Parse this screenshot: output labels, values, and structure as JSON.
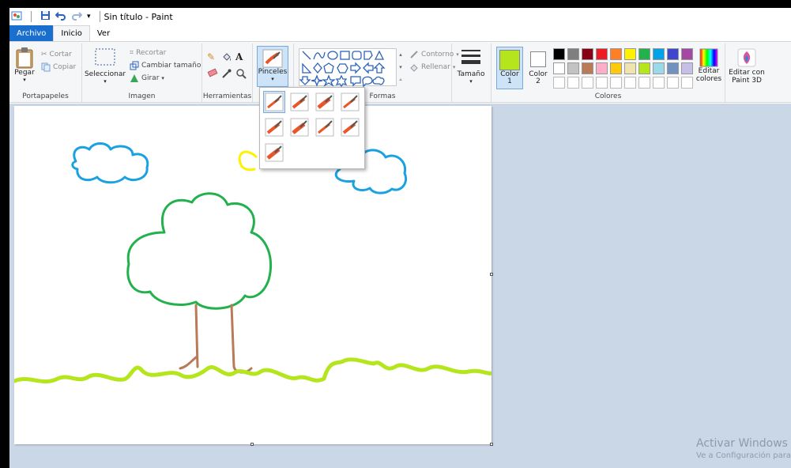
{
  "titlebar": {
    "title": "Sin título - Paint",
    "icons": [
      "paint-app-icon",
      "save-icon",
      "undo-icon",
      "redo-icon",
      "customize-qat-icon"
    ]
  },
  "tabs": {
    "file": "Archivo",
    "home": "Inicio",
    "view": "Ver"
  },
  "clipboard": {
    "paste": "Pegar",
    "cut": "Cortar",
    "copy": "Copiar",
    "title": "Portapapeles"
  },
  "image": {
    "select": "Seleccionar",
    "crop": "Recortar",
    "resize": "Cambiar tamaño",
    "rotate": "Girar",
    "title": "Imagen"
  },
  "tools": {
    "title": "Herramientas"
  },
  "brushes": {
    "label": "Pinceles"
  },
  "shapes": {
    "outline": "Contorno",
    "fill": "Rellenar",
    "title": "Formas"
  },
  "size": {
    "label": "Tamaño"
  },
  "colors": {
    "color1_label": "Color",
    "color1_num": "1",
    "color2_label": "Color",
    "color2_num": "2",
    "edit": "Editar colores",
    "title": "Colores",
    "color1": "#b5e61d",
    "color2": "#ffffff",
    "palette_row1": [
      "#000000",
      "#7f7f7f",
      "#880015",
      "#ed1c24",
      "#ff7f27",
      "#fff200",
      "#22b14c",
      "#00a2e8",
      "#3f48cc",
      "#a349a4"
    ],
    "palette_row2": [
      "#ffffff",
      "#c3c3c3",
      "#b97a57",
      "#ffaec9",
      "#ffc90e",
      "#efe4b0",
      "#b5e61d",
      "#99d9ea",
      "#7092be",
      "#c8bfe7"
    ],
    "palette_row3": [
      "#ffffff",
      "#ffffff",
      "#ffffff",
      "#ffffff",
      "#ffffff",
      "#ffffff",
      "#ffffff",
      "#ffffff",
      "#ffffff",
      "#ffffff"
    ]
  },
  "paint3d": {
    "label": "Editar con Paint 3D"
  },
  "drawing": {
    "cloud_color": "#1ba1e2",
    "tree_color": "#22b14c",
    "trunk_color": "#b97a57",
    "grass_color": "#b5e61d",
    "sun_color": "#fff200"
  },
  "watermark": {
    "line1": "Activar Windows",
    "line2": "Ve a Configuración para"
  }
}
